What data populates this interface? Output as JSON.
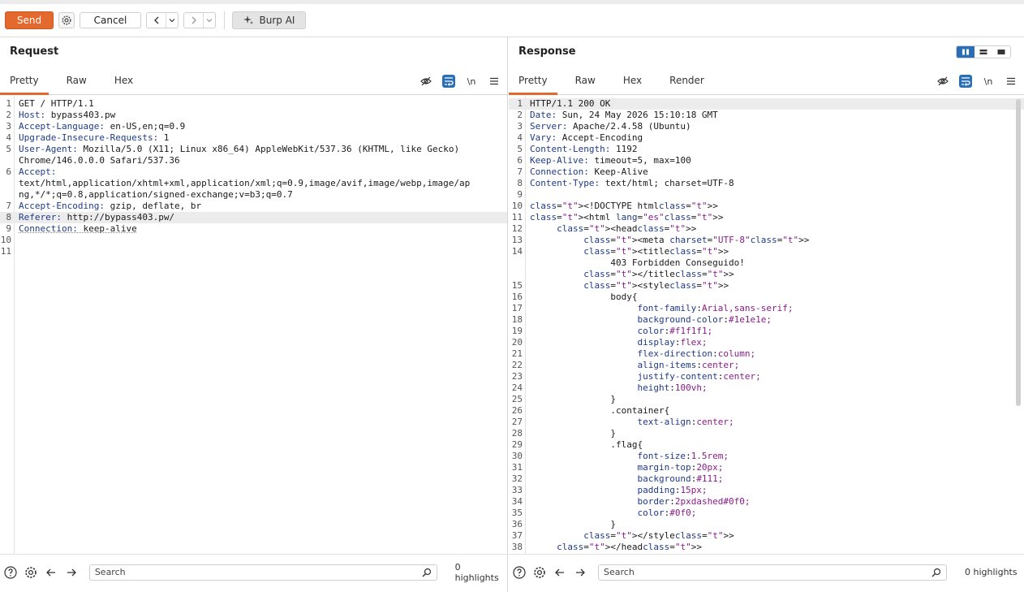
{
  "toolbar": {
    "send_label": "Send",
    "cancel_label": "Cancel",
    "burp_ai_label": "Burp AI"
  },
  "request": {
    "title": "Request",
    "tabs": [
      "Pretty",
      "Raw",
      "Hex"
    ],
    "active_tab": "Pretty",
    "tools": {
      "newline_label": "\\n"
    },
    "lines": [
      "GET / HTTP/1.1",
      "Host: bypass403.pw",
      "Accept-Language: en-US,en;q=0.9",
      "Upgrade-Insecure-Requests: 1",
      "User-Agent: Mozilla/5.0 (X11; Linux x86_64) AppleWebKit/537.36 (KHTML, like Gecko)",
      "Chrome/146.0.0.0 Safari/537.36",
      "Accept:",
      "text/html,application/xhtml+xml,application/xml;q=0.9,image/avif,image/webp,image/ap",
      "ng,*/*;q=0.8,application/signed-exchange;v=b3;q=0.7",
      "Accept-Encoding: gzip, deflate, br",
      "Referer: http://bypass403.pw/",
      "Connection: keep-alive",
      "",
      ""
    ],
    "line_numbers": [
      "1",
      "2",
      "3",
      "4",
      "5",
      "",
      "6",
      "",
      "",
      "7",
      "8",
      "9",
      "10",
      "11"
    ],
    "search_placeholder": "Search",
    "highlights": "0 highlights"
  },
  "response": {
    "title": "Response",
    "tabs": [
      "Pretty",
      "Raw",
      "Hex",
      "Render"
    ],
    "active_tab": "Pretty",
    "tools": {
      "newline_label": "\\n"
    },
    "lines": [
      "HTTP/1.1 200 OK",
      "Date: Sun, 24 May 2026 15:10:18 GMT",
      "Server: Apache/2.4.58 (Ubuntu)",
      "Vary: Accept-Encoding",
      "Content-Length: 1192",
      "Keep-Alive: timeout=5, max=100",
      "Connection: Keep-Alive",
      "Content-Type: text/html; charset=UTF-8",
      "",
      "<!DOCTYPE html>",
      "<html lang=\"es\">",
      "     <head>",
      "          <meta charset=\"UTF-8\">",
      "          <title>",
      "               403 Forbidden Conseguido!",
      "          </title>",
      "          <style>",
      "               body{",
      "                    font-family:Arial,sans-serif;",
      "                    background-color:#1e1e1e;",
      "                    color:#f1f1f1;",
      "                    display:flex;",
      "                    flex-direction:column;",
      "                    align-items:center;",
      "                    justify-content:center;",
      "                    height:100vh;",
      "               }",
      "               .container{",
      "                    text-align:center;",
      "               }",
      "               .flag{",
      "                    font-size:1.5rem;",
      "                    margin-top:20px;",
      "                    background:#111;",
      "                    padding:15px;",
      "                    border:2pxdashed#0f0;",
      "                    color:#0f0;",
      "               }",
      "          </style>",
      "     </head>"
    ],
    "line_numbers": [
      "1",
      "2",
      "3",
      "4",
      "5",
      "6",
      "7",
      "8",
      "9",
      "10",
      "11",
      "12",
      "13",
      "14",
      "",
      "",
      "15",
      "16",
      "17",
      "18",
      "19",
      "20",
      "21",
      "22",
      "23",
      "24",
      "25",
      "26",
      "27",
      "28",
      "29",
      "30",
      "31",
      "32",
      "33",
      "34",
      "35",
      "36",
      "37",
      "38"
    ],
    "search_placeholder": "Search",
    "highlights": "0 highlights"
  }
}
